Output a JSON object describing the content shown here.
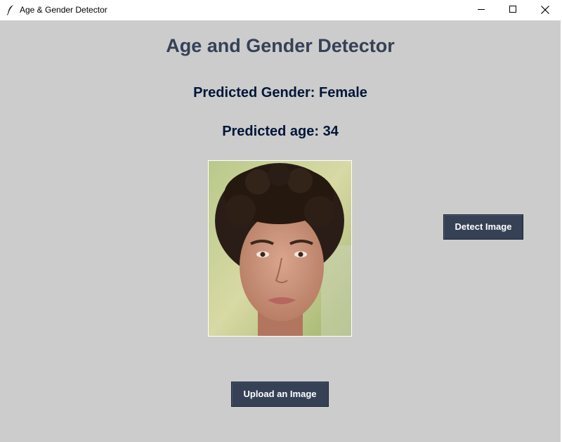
{
  "window": {
    "title": "Age & Gender Detector",
    "icon": "feather-icon",
    "controls": [
      "minimize-icon",
      "maximize-icon",
      "close-icon"
    ]
  },
  "app": {
    "heading": "Age and Gender Detector",
    "predicted_gender": "Predicted Gender: Female",
    "predicted_age": "Predicted age: 34",
    "detect_button": "Detect Image",
    "upload_button": "Upload an Image"
  },
  "colors": {
    "background": "#cccccc",
    "heading": "#364156",
    "labels": "#011638",
    "button_bg": "#364156",
    "button_text": "#ffffff"
  }
}
